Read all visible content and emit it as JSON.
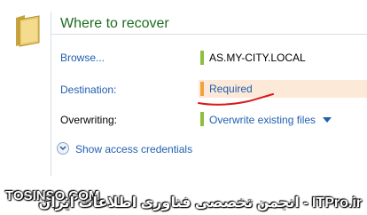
{
  "section": {
    "title": "Where to recover"
  },
  "rows": {
    "browse": {
      "label": "Browse...",
      "value": "AS.MY-CITY.LOCAL"
    },
    "destination": {
      "label": "Destination:",
      "value": "Required"
    },
    "overwriting": {
      "label": "Overwriting:",
      "value": "Overwrite existing files"
    }
  },
  "credentials": {
    "label": "Show access credentials"
  },
  "watermark": {
    "left": "TOSINSO.COM",
    "right": "انجمن تخصصی فناوری اطلاعات ایران - ITPro.ir"
  },
  "colors": {
    "title": "#1e6e1e",
    "link": "#1f5fb0",
    "ok_bar": "#8cbf3f",
    "required_bar": "#f2a23c",
    "required_bg": "#fde9d7",
    "annotation": "#d91a1a"
  }
}
